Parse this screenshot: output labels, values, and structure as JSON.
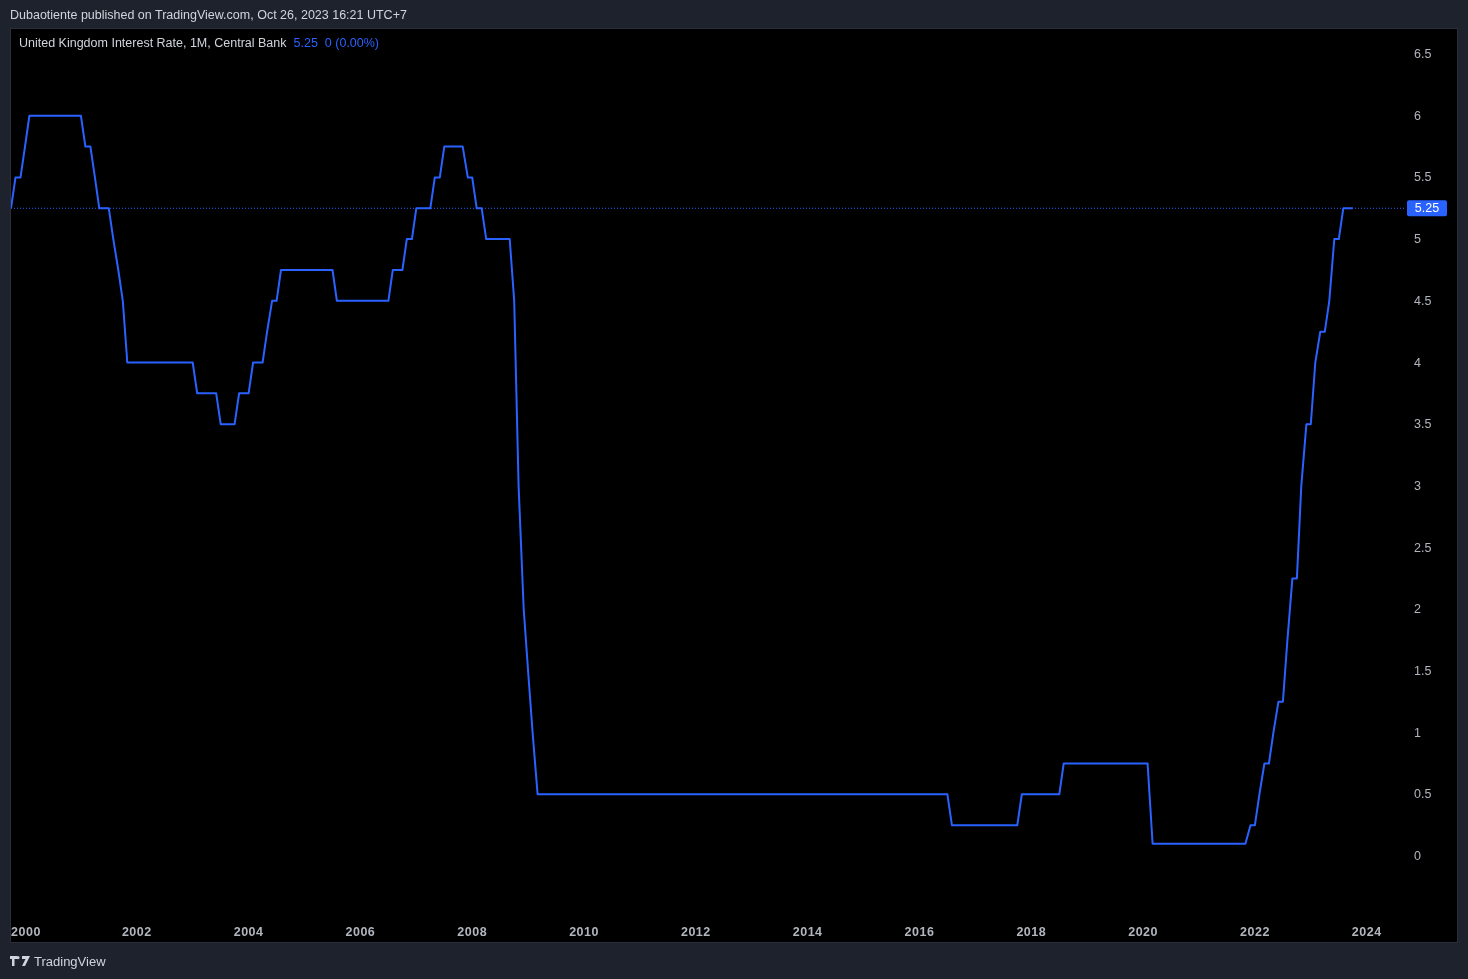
{
  "header": {
    "text": "Dubaotiente published on TradingView.com, Oct 26, 2023 16:21 UTC+7"
  },
  "legend": {
    "value": "5.25",
    "change": "0 (0.00%)"
  },
  "chart_data": {
    "type": "line",
    "x": [
      1999.75,
      1999.83,
      1999.92,
      2000.0,
      2000.08,
      2001.0,
      2001.08,
      2001.17,
      2001.25,
      2001.33,
      2001.5,
      2001.58,
      2001.67,
      2001.75,
      2001.83,
      2003.0,
      2003.08,
      2003.42,
      2003.5,
      2003.75,
      2003.83,
      2004.0,
      2004.08,
      2004.25,
      2004.33,
      2004.42,
      2004.5,
      2004.58,
      2005.5,
      2005.58,
      2006.5,
      2006.58,
      2006.75,
      2006.83,
      2006.92,
      2007.0,
      2007.25,
      2007.33,
      2007.42,
      2007.5,
      2007.83,
      2007.92,
      2008.0,
      2008.08,
      2008.17,
      2008.25,
      2008.67,
      2008.75,
      2008.83,
      2008.92,
      2009.0,
      2009.08,
      2009.17,
      2016.5,
      2016.58,
      2017.75,
      2017.83,
      2018.5,
      2018.58,
      2020.08,
      2020.17,
      2021.83,
      2021.92,
      2022.0,
      2022.08,
      2022.17,
      2022.25,
      2022.33,
      2022.42,
      2022.5,
      2022.58,
      2022.67,
      2022.75,
      2022.83,
      2022.92,
      2023.0,
      2023.08,
      2023.17,
      2023.25,
      2023.33,
      2023.42,
      2023.5,
      2023.58,
      2023.75
    ],
    "series": [
      {
        "name": "United Kingdom Interest Rate, 1M, Central Bank",
        "color": "#2962ff",
        "values": [
          5.25,
          5.5,
          5.5,
          5.75,
          6.0,
          6.0,
          5.75,
          5.75,
          5.5,
          5.25,
          5.25,
          5.0,
          4.75,
          4.5,
          4.0,
          4.0,
          3.75,
          3.75,
          3.5,
          3.5,
          3.75,
          3.75,
          4.0,
          4.0,
          4.25,
          4.5,
          4.5,
          4.75,
          4.75,
          4.5,
          4.5,
          4.75,
          4.75,
          5.0,
          5.0,
          5.25,
          5.25,
          5.5,
          5.5,
          5.75,
          5.75,
          5.5,
          5.5,
          5.25,
          5.25,
          5.0,
          5.0,
          4.5,
          3.0,
          2.0,
          1.5,
          1.0,
          0.5,
          0.5,
          0.25,
          0.25,
          0.5,
          0.5,
          0.75,
          0.75,
          0.1,
          0.1,
          0.25,
          0.25,
          0.5,
          0.75,
          0.75,
          1.0,
          1.25,
          1.25,
          1.75,
          2.25,
          2.25,
          3.0,
          3.5,
          3.5,
          4.0,
          4.25,
          4.25,
          4.5,
          5.0,
          5.0,
          5.25,
          5.25
        ]
      }
    ],
    "xlim": [
      1999.75,
      2025.65
    ],
    "ylim": [
      -0.713,
      6.703
    ],
    "xticks": [
      2000,
      2002,
      2004,
      2006,
      2008,
      2010,
      2012,
      2014,
      2016,
      2018,
      2020,
      2022,
      2024
    ],
    "yticks": [
      0,
      0.5,
      1,
      1.5,
      2,
      2.5,
      3,
      3.5,
      4,
      4.5,
      5,
      5.5,
      6,
      6.5
    ],
    "ref_lines": [
      {
        "axis": "y",
        "value": 5.25,
        "label": "5.25",
        "color": "#2962ff"
      }
    ]
  },
  "footer": {
    "brand": "TradingView"
  }
}
